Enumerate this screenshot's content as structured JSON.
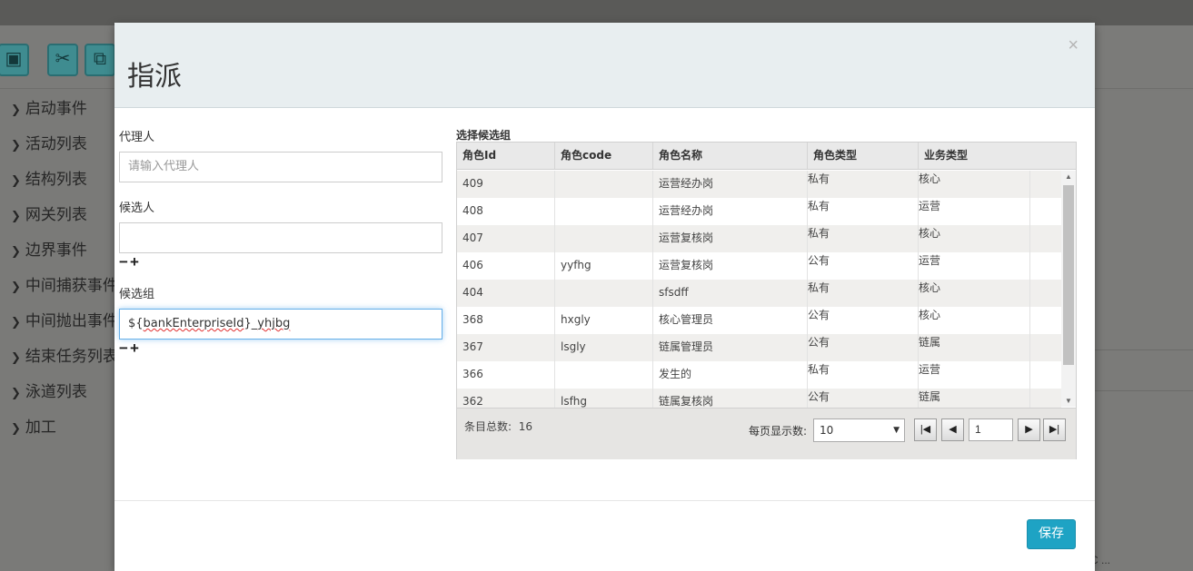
{
  "background": {
    "sidebar_items": [
      "启动事件",
      "活动列表",
      "结构列表",
      "网关列表",
      "边界事件",
      "中间捕获事件",
      "中间抛出事件",
      "结束任务列表",
      "泳道列表",
      "加工"
    ],
    "tool_icons": [
      "save-icon",
      "scissors-icon",
      "copy-icon"
    ],
    "right_fragment": "C ..."
  },
  "modal": {
    "title": "指派",
    "close": "×",
    "agent": {
      "label": "代理人",
      "placeholder": "请输入代理人",
      "value": ""
    },
    "candidate_user": {
      "label": "候选人",
      "value": "",
      "minus": "−",
      "plus": "+"
    },
    "candidate_group": {
      "label": "候选组",
      "value_part1": "${",
      "value_part2": "bankEnterpriseId",
      "value_part3": "}_",
      "value_part4": "yhjbg",
      "minus": "−",
      "plus": "+"
    },
    "grid": {
      "title": "选择候选组",
      "columns": [
        "角色Id",
        "角色code",
        "角色名称",
        "角色类型",
        "业务类型"
      ],
      "rows": [
        [
          "409",
          "",
          "运营经办岗",
          "私有",
          "核心"
        ],
        [
          "408",
          "",
          "运营经办岗",
          "私有",
          "运营"
        ],
        [
          "407",
          "",
          "运营复核岗",
          "私有",
          "核心"
        ],
        [
          "406",
          "yyfhg",
          "运营复核岗",
          "公有",
          "运营"
        ],
        [
          "404",
          "",
          "sfsdff",
          "私有",
          "核心"
        ],
        [
          "368",
          "hxgly",
          "核心管理员",
          "公有",
          "核心"
        ],
        [
          "367",
          "lsgly",
          "链属管理员",
          "公有",
          "链属"
        ],
        [
          "366",
          "",
          "发生的",
          "私有",
          "运营"
        ],
        [
          "362",
          "lsfhg",
          "链属复核岗",
          "公有",
          "链属"
        ]
      ],
      "total_label": "条目总数:",
      "total_value": "16",
      "per_page_label": "每页显示数:",
      "per_page_value": "10",
      "page_value": "1",
      "pager": {
        "first": "|◀",
        "prev": "◀",
        "next": "▶",
        "last": "▶|"
      }
    },
    "save_label": "保存"
  }
}
